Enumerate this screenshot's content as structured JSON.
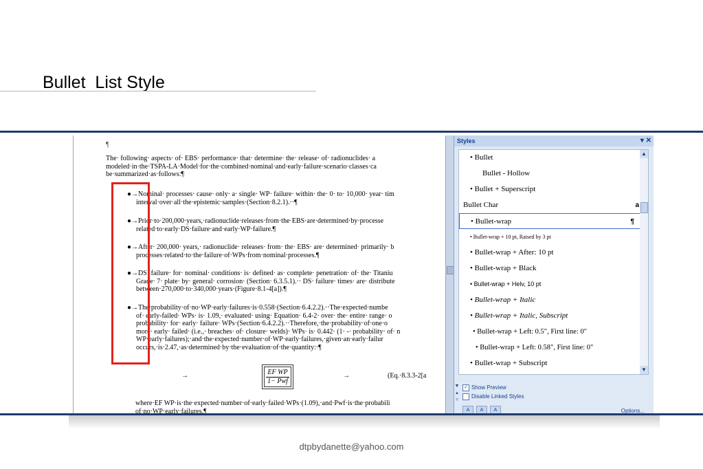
{
  "slide": {
    "title": "Bullet  List Style",
    "footer": "dtpbydanette@yahoo.com"
  },
  "document": {
    "pilcrow": "¶",
    "intro_lines": [
      "The· following· aspects· of· EBS· performance· that· determine· the· release· of· radionuclides· a",
      "modeled·in·the·TSPA-LA·Model·for·the·combined·nominal·and·early·failure·scenario·classes·ca",
      "be·summarized·as·follows:¶"
    ],
    "bullets": [
      {
        "line1": "●→Nominal· processes· cause· only· a· single· WP· failure· within· the· 0· to· 10,000· year· tim",
        "line2": "interval·over·all·the·epistemic·samples·(Section·8.2.1).··¶"
      },
      {
        "line1": "●→Prior·to·200,000·years,·radionuclide·releases·from·the·EBS·are·determined·by·processe",
        "line2": "related·to·early·DS·failure·and·early·WP·failure.¶"
      },
      {
        "line1": "●→After· 200,000· years,· radionuclide· releases· from· the· EBS· are· determined· primarily· b",
        "line2": "processes·related·to·the·failure·of·WPs·from·nominal·processes.¶"
      },
      {
        "line1": "●→DS· failure· for· nominal· conditions· is· defined· as· complete· penetration· of· the· Titaniu",
        "line2": "Grade· 7· plate· by· general· corrosion· (Section· 6.3.5.1).·· DS· failure· times· are· distribute",
        "line3": "between·270,000·to·340,000·years·(Figure·8.1-4[a]).¶"
      },
      {
        "line1": "●→The·probability·of·no·WP·early·failures·is·0.558·(Section·6.4.2.2).··The·expected·numbe",
        "line2": "of· early-failed· WPs· is· 1.09,· evaluated· using· Equation· 6.4-2· over· the· entire· range· o",
        "line3": "probability· for· early· failure· WPs·(Section·6.4.2.2).··Therefore,·the·probability·of·one·o",
        "line4": "more· early· failed· (i.e.,· breaches· of· closure· welds)· WPs· is· 0.442· (1· -· probability· of· n",
        "line5": "WP·early·failures);·and·the·expected·number·of·WP·early·failures,·given·an·early·failur",
        "line6": "occurs,·is·2.47,·as·determined·by·the·evaluation·of·the·quantity:·¶"
      }
    ],
    "equation": {
      "numerator": "EF WP",
      "denominator": "1− Pwf",
      "arrow": "→",
      "label": "(Eq.·8.3.3-2[a"
    },
    "where_line": "where·EF WP·is·the·expected·number·of·early·failed·WPs·(1.09),·and·Pwf·is·the·probabili",
    "where_line2": "of·no·WP·early·failures.¶"
  },
  "styles_panel": {
    "title": "Styles",
    "items": [
      {
        "label": "•  Bullet",
        "mark": "¶"
      },
      {
        "label": "Bullet - Hollow",
        "mark": "¶"
      },
      {
        "label": "•  Bullet + Superscript",
        "mark": ""
      },
      {
        "label": "Bullet Char",
        "mark": "a"
      },
      {
        "label": "•  Bullet-wrap",
        "mark": "¶"
      },
      {
        "label": "•  Bullet-wrap + 10 pt, Raised by  3 pt",
        "mark": ""
      },
      {
        "label": "•  Bullet-wrap + After:  10 pt",
        "mark": ""
      },
      {
        "label": "•  Bullet-wrap + Black",
        "mark": ""
      },
      {
        "label": "•  Bullet-wrap + Helv, 10 pt",
        "mark": ""
      },
      {
        "label": "•  Bullet-wrap + Italic",
        "mark": ""
      },
      {
        "label": "•  Bullet-wrap + Italic, Subscript",
        "mark": ""
      },
      {
        "label": "•  Bullet-wrap + Left:  0.5\", First line:  0\"",
        "mark": ""
      },
      {
        "label": "•  Bullet-wrap + Left:  0.58\", First line:  0\"",
        "mark": ""
      },
      {
        "label": "•  Bullet-wrap + Subscript",
        "mark": ""
      }
    ],
    "show_preview": "Show Preview",
    "disable_linked": "Disable Linked Styles",
    "options": "Options..."
  }
}
